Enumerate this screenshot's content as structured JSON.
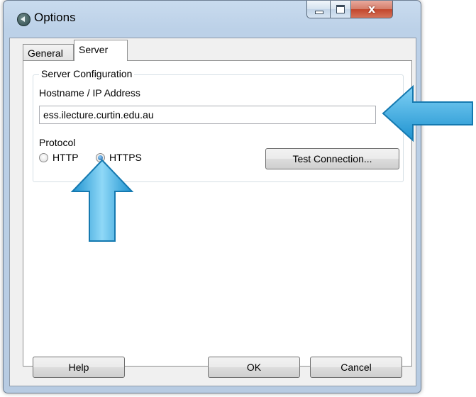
{
  "window": {
    "title": "Options",
    "close_glyph": "x"
  },
  "tabs": [
    {
      "label": "General"
    },
    {
      "label": "Server"
    }
  ],
  "server_config": {
    "group_title": "Server Configuration",
    "hostname_label": "Hostname / IP Address",
    "hostname_value": "ess.ilecture.curtin.edu.au",
    "protocol_label": "Protocol",
    "protocols": [
      {
        "label": "HTTP",
        "checked": false
      },
      {
        "label": "HTTPS",
        "checked": true
      }
    ],
    "test_button": "Test Connection..."
  },
  "footer": {
    "help": "Help",
    "ok": "OK",
    "cancel": "Cancel"
  },
  "annotations": {
    "arrow_color": "#2aa3dc"
  }
}
